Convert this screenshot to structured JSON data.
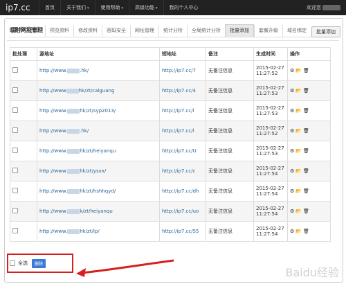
{
  "brand": "ip7.cc",
  "nav": [
    {
      "label": "首页"
    },
    {
      "label": "关于我们",
      "caret": "▾"
    },
    {
      "label": "使用帮助",
      "caret": "▾"
    },
    {
      "label": "高级功能",
      "caret": "▾"
    },
    {
      "label": "我的个人中心"
    }
  ],
  "welcome": "欢迎您",
  "tabs": {
    "title": "用户资料",
    "items": [
      "预览资料",
      "修改资料",
      "密码安全",
      "网址管理",
      "统计分析",
      "全局统计分析",
      "批量添加",
      "套餐升级",
      "域名绑定"
    ]
  },
  "section": {
    "title": "临时网址管理",
    "add_button": "批量添加"
  },
  "table": {
    "headers": [
      "批处理",
      "源地址",
      "短地址",
      "备注",
      "生成时间",
      "操作"
    ],
    "rows": [
      {
        "src": "http://www.",
        "src_tail": ".hk/",
        "short": "http://ip7.cc/7",
        "note": "无备注信息",
        "time": "2015-02-27 11:27:52"
      },
      {
        "src": "http://www",
        "src_tail": "hk/zt/caiguang",
        "short": "http://ip7.cc/4",
        "note": "无备注信息",
        "time": "2015-02-27 11:27:53"
      },
      {
        "src": "http://www.",
        "src_tail": "hk/zt/syp2013/",
        "short": "http://ip7.cc/l",
        "note": "无备注信息",
        "time": "2015-02-27 11:27:53"
      },
      {
        "src": "http://www.",
        "src_tail": ".hk/",
        "short": "http://ip7.cc/l",
        "note": "无备注信息",
        "time": "2015-02-27 11:27:52"
      },
      {
        "src": "http://www.",
        "src_tail": "hk/zt/heiyanqu",
        "short": "http://ip7.cc/U",
        "note": "无备注信息",
        "time": "2015-02-27 11:27:53"
      },
      {
        "src": "http://www.",
        "src_tail": "hk/zt/ysxx/",
        "short": "http://ip7.cc/c",
        "note": "无备注信息",
        "time": "2015-02-27 11:27:54"
      },
      {
        "src": "http://www.",
        "src_tail": "hk/zt/hshhqyd/",
        "short": "http://ip7.cc/dh",
        "note": "无备注信息",
        "time": "2015-02-27 11:27:54"
      },
      {
        "src": "http://www.",
        "src_tail": "k/zt/heiyanqu",
        "short": "http://ip7.cc/uo",
        "note": "无备注信息",
        "time": "2015-02-27 11:27:54"
      },
      {
        "src": "http://www.",
        "src_tail": "hk/zt/lp/",
        "short": "http://ip7.cc/55",
        "note": "无备注信息",
        "time": "2015-02-27 11:27:54"
      }
    ]
  },
  "ops": {
    "settings": "⚙",
    "folder": "📂",
    "delete": "🗑"
  },
  "bottom": {
    "select_all": "全选",
    "delete_button": "删除"
  },
  "watermark": "Baidu经验",
  "colors": {
    "topbar": "#222222",
    "highlight": "#d62020",
    "button": "#3a7bd5"
  }
}
